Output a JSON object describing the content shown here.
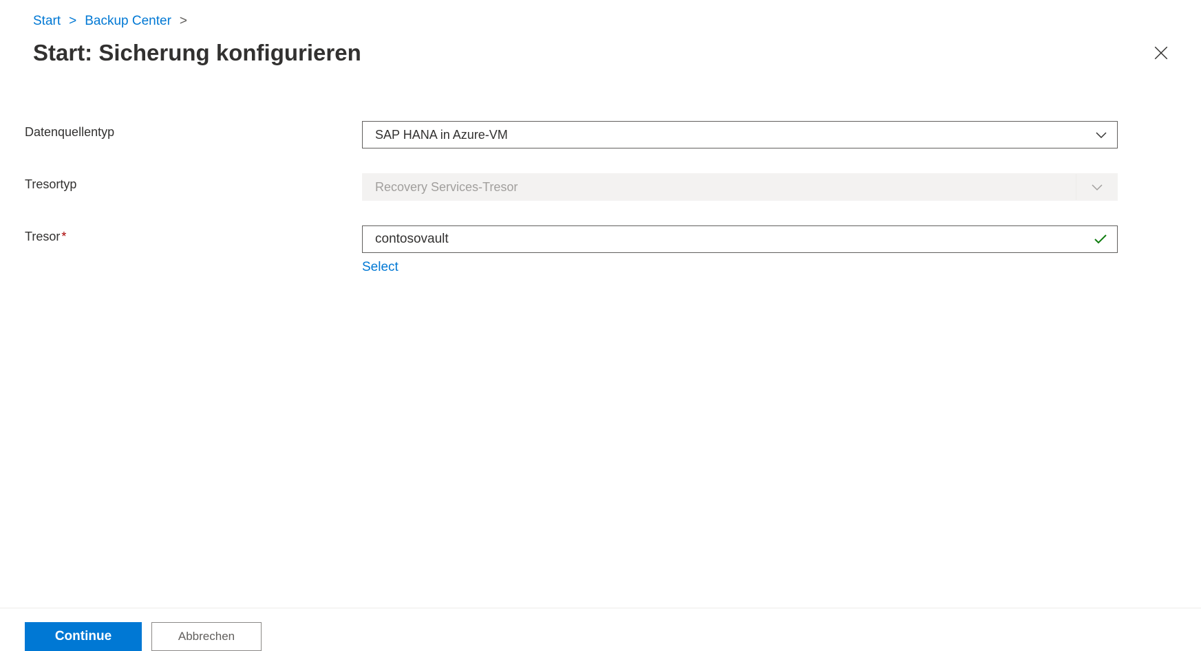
{
  "breadcrumb": {
    "item1": "Start",
    "item2": "Backup Center"
  },
  "header": {
    "title": "Start: Sicherung konfigurieren"
  },
  "form": {
    "datasource_label": "Datenquellentyp",
    "datasource_value": "SAP HANA in Azure-VM",
    "vaultType_label": "Tresortyp",
    "vaultType_value": "Recovery Services-Tresor",
    "vault_label": "Tresor",
    "vault_value": "contosovault",
    "select_link": "Select"
  },
  "footer": {
    "continue": "Continue",
    "cancel": "Abbrechen"
  }
}
